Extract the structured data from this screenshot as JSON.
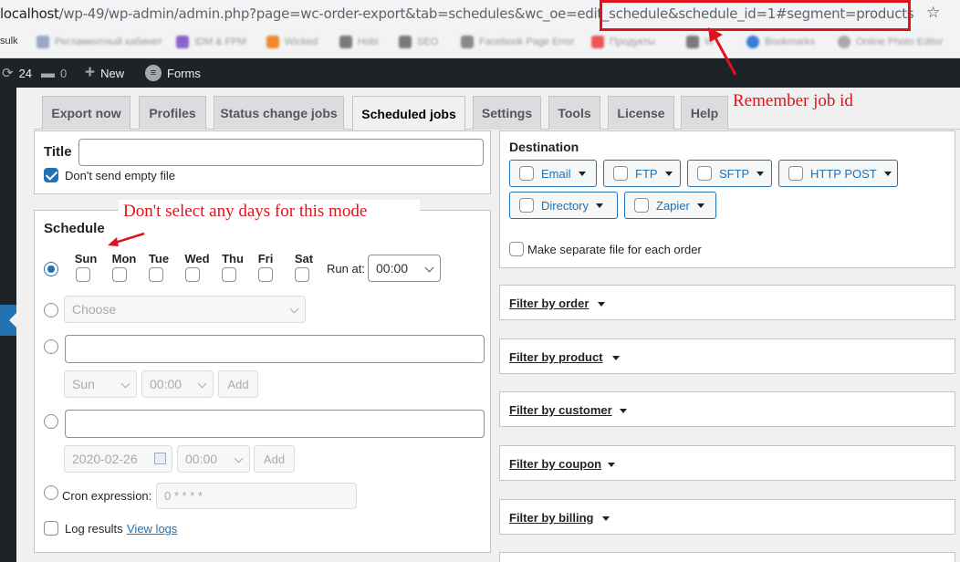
{
  "browser": {
    "url_host": "localhost",
    "url_path": "/wp-49/wp-admin/admin.php?page=wc-order-export&tab=schedules&wc_oe=edit_schedule&schedule_id=1#segment=products",
    "bookmark_first": "sulk"
  },
  "adminbar": {
    "updates_count": "24",
    "comments_count": "0",
    "new_label": "New",
    "forms_label": "Forms"
  },
  "tabs": [
    "Export now",
    "Profiles",
    "Status change jobs",
    "Scheduled jobs",
    "Settings",
    "Tools",
    "License",
    "Help"
  ],
  "active_tab": "Scheduled jobs",
  "title_section": {
    "label": "Title",
    "value": "",
    "dont_send_empty": "Don't send empty file",
    "dont_send_empty_checked": true
  },
  "schedule": {
    "label": "Schedule",
    "days": [
      "Sun",
      "Mon",
      "Tue",
      "Wed",
      "Thu",
      "Fri",
      "Sat"
    ],
    "run_at_label": "Run at:",
    "run_at_value": "00:00",
    "choose_placeholder": "Choose",
    "weekly_day": "Sun",
    "weekly_time": "00:00",
    "add_label": "Add",
    "date_value": "2020-02-26",
    "date_time": "00:00",
    "cron_label": "Cron expression:",
    "cron_placeholder": "0 * * * *",
    "log_results_label": "Log results",
    "view_logs_label": "View logs"
  },
  "destination": {
    "label": "Destination",
    "buttons": [
      "Email",
      "FTP",
      "SFTP",
      "HTTP POST",
      "Directory",
      "Zapier"
    ],
    "separate_file_label": "Make separate file for each order"
  },
  "filters": [
    "Filter by order",
    "Filter by product",
    "Filter by customer",
    "Filter by coupon",
    "Filter by billing"
  ],
  "annotations": {
    "remember_job_id": "Remember job id",
    "dont_select_days": "Don't  select  any  days  for  this  mode"
  },
  "colors": {
    "annotation_red": "#e0121b",
    "wp_blue": "#2271b1",
    "admin_bar": "#1d2327"
  }
}
